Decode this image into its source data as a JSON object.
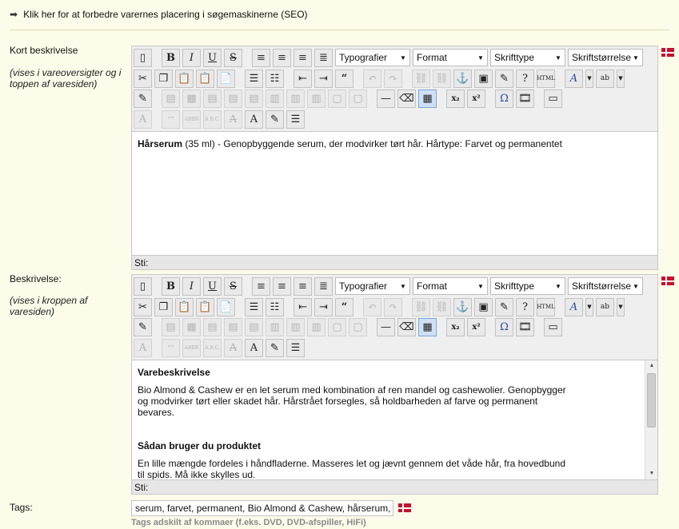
{
  "seo": {
    "label": "Klik her for at forbedre varernes placering i søgemaskinerne (SEO)",
    "icon": "arrow-right-icon"
  },
  "short": {
    "label": "Kort beskrivelse",
    "note": "(vises i vareoversigter og i toppen af varesiden)",
    "content_bold": "Hårserum",
    "content_rest": " (35 ml) - Genopbyggende serum, der modvirker tørt hår. Hårtype: Farvet og permanentet",
    "status": "Sti:"
  },
  "long": {
    "label": "Beskrivelse:",
    "note": "(vises i kroppen af varesiden)",
    "h1": "Varebeskrivelse",
    "p1": "Bio Almond & Cashew er en let serum med kombination af ren mandel og cashewolier. Genopbygger og modvirker tørt eller skadet hår. Hårstrået forsegles, så holdbarheden af farve og permanent bevares.",
    "h2": "Sådan bruger du produktet",
    "p2": "En lille mængde fordeles i håndfladerne. Masseres let og jævnt gennem det våde hår, fra hovedbund til spids. Må ikke skylles ud.",
    "status": "Sti:"
  },
  "toolbar": {
    "typografier": "Typografier",
    "format": "Format",
    "skrifttype": "Skrifttype",
    "skriftstorrelse": "Skriftstørrelse"
  },
  "tags": {
    "label": "Tags:",
    "value": "serum, farvet, permanent, Bio Almond & Cashew, hårserum,",
    "hint": "Tags adskilt af kommaer (f.eks. DVD, DVD-afspiller, HiFi)"
  },
  "colors": {
    "background": "#fdfbe9",
    "flag": "#c8102e"
  }
}
